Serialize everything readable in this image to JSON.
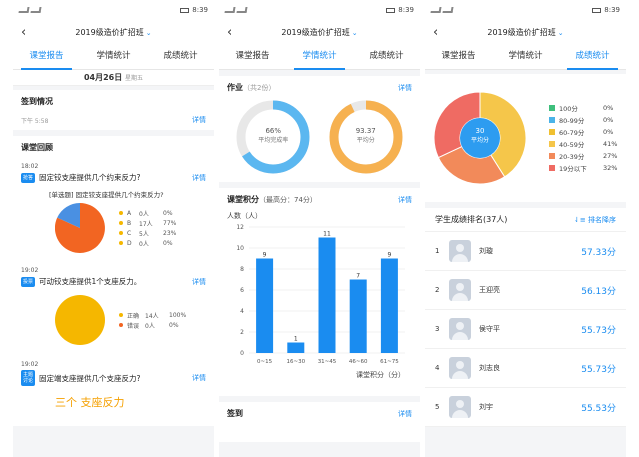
{
  "status": {
    "time": "8:39"
  },
  "title": "2019级造价扩招班",
  "tabs": [
    "课堂报告",
    "学情统计",
    "成绩统计"
  ],
  "p1": {
    "date": "04月26日",
    "date_sub": "星期五",
    "signin_title": "签到情况",
    "signin_sub": "下午 5:58",
    "detail": "详情",
    "review_title": "课堂回顾",
    "items": [
      {
        "time": "18:02",
        "badge": "抢答",
        "question": "固定铰支座提供几个约束反力?",
        "sub": "[单选题] 固定铰支座提供几个约束反力?",
        "legend": [
          {
            "label": "A",
            "count": "0人",
            "pct": "0%",
            "color": "#4a90e2"
          },
          {
            "label": "B",
            "count": "17人",
            "pct": "77%",
            "color": "#f26522"
          },
          {
            "label": "C",
            "count": "5人",
            "pct": "23%",
            "color": "#4a90e2"
          },
          {
            "label": "D",
            "count": "0人",
            "pct": "0%",
            "color": "#4a90e2"
          }
        ]
      },
      {
        "time": "19:02",
        "badge": "投票",
        "question": "可动铰支座提供1个支座反力。",
        "legend": [
          {
            "label": "正确",
            "count": "14人",
            "pct": "100%",
            "color": "#f5b700"
          },
          {
            "label": "错误",
            "count": "0人",
            "pct": "0%",
            "color": "#f26522"
          }
        ]
      },
      {
        "time": "19:02",
        "badge": "主题讨论",
        "question": "固定端支座提供几个支座反力?",
        "answer": "三个  支座反力"
      }
    ]
  },
  "p2": {
    "homework_title": "作业",
    "homework_count": "（共2份）",
    "detail": "详情",
    "ring1_value": "66%",
    "ring1_label": "平均完成率",
    "ring1_fraction": 0.66,
    "ring2_value": "93.37",
    "ring2_label": "平均分",
    "ring2_fraction": 0.93,
    "score_title": "课堂积分",
    "score_max": "（最高分：74分）",
    "signin_title": "签到"
  },
  "chart_data": {
    "type": "bar",
    "ylabel": "人数（人）",
    "xlabel": "课堂积分（分）",
    "categories": [
      "0~15",
      "16~30",
      "31~45",
      "46~60",
      "61~75"
    ],
    "values": [
      9,
      1,
      11,
      7,
      9
    ],
    "ylim": [
      0,
      12
    ],
    "yticks": [
      0,
      2,
      4,
      6,
      8,
      10,
      12
    ],
    "grid": true,
    "color": "#1a8cf0"
  },
  "p3": {
    "center_value": "30",
    "center_label": "平均分",
    "dist": [
      {
        "label": "100分",
        "pct": "0%",
        "color": "#3ebf7c",
        "value": 0
      },
      {
        "label": "80-99分",
        "pct": "0%",
        "color": "#4ab3e8",
        "value": 0
      },
      {
        "label": "60-79分",
        "pct": "0%",
        "color": "#f0c030",
        "value": 0
      },
      {
        "label": "40-59分",
        "pct": "41%",
        "color": "#f5c64a",
        "value": 41
      },
      {
        "label": "20-39分",
        "pct": "27%",
        "color": "#f28a5a",
        "value": 27
      },
      {
        "label": "19分以下",
        "pct": "32%",
        "color": "#ef6b63",
        "value": 32
      }
    ],
    "rank_title": "学生成绩排名(37人)",
    "sort_label": "排名降序",
    "ranks": [
      {
        "no": "1",
        "name": "刘璇",
        "score": "57.33分"
      },
      {
        "no": "2",
        "name": "王迎亮",
        "score": "56.13分"
      },
      {
        "no": "3",
        "name": "侯守平",
        "score": "55.73分"
      },
      {
        "no": "4",
        "name": "刘志良",
        "score": "55.73分"
      },
      {
        "no": "5",
        "name": "刘宇",
        "score": "55.53分"
      }
    ]
  }
}
